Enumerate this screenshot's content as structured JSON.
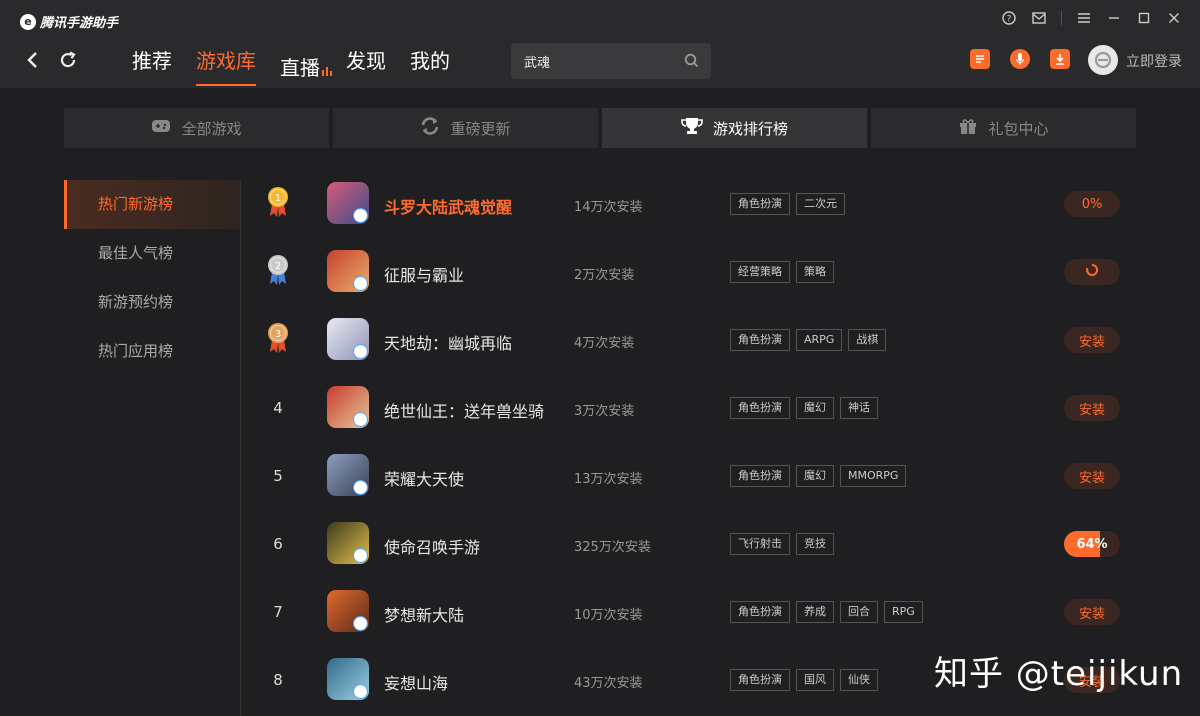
{
  "app": {
    "brand": "腾讯手游助手",
    "logo_letter": "e"
  },
  "window_controls": [
    "help-icon",
    "mail-icon",
    "menu-icon",
    "minimize-icon",
    "maximize-icon",
    "close-icon"
  ],
  "nav": {
    "tabs": [
      {
        "label": "推荐",
        "active": false
      },
      {
        "label": "游戏库",
        "active": true
      },
      {
        "label": "直播",
        "active": false,
        "live": true
      },
      {
        "label": "发现",
        "active": false
      },
      {
        "label": "我的",
        "active": false
      }
    ]
  },
  "search": {
    "value": "武魂"
  },
  "header": {
    "login_label": "立即登录"
  },
  "category_tabs": [
    {
      "label": "全部游戏",
      "icon": "gamepad-icon",
      "active": false
    },
    {
      "label": "重磅更新",
      "icon": "refresh-icon",
      "active": false
    },
    {
      "label": "游戏排行榜",
      "icon": "trophy-icon",
      "active": true
    },
    {
      "label": "礼包中心",
      "icon": "gift-icon",
      "active": false
    }
  ],
  "sidebar": {
    "items": [
      {
        "label": "热门新游榜",
        "active": true
      },
      {
        "label": "最佳人气榜",
        "active": false
      },
      {
        "label": "新游预约榜",
        "active": false
      },
      {
        "label": "热门应用榜",
        "active": false
      }
    ]
  },
  "colors": {
    "accent": "#ff6b2b",
    "gold": "#f5b82e",
    "silver": "#c9c9c9",
    "bronze": "#e3a35d"
  },
  "games": [
    {
      "rank": "1",
      "medal": "gold",
      "name": "斗罗大陆武魂觉醒",
      "hot": true,
      "installs": "14万次安装",
      "tags": [
        "角色扮演",
        "二次元"
      ],
      "action": "0%",
      "action_type": "percent",
      "progress": 0,
      "icon_colors": [
        "#d85c7a",
        "#3d4c8a"
      ]
    },
    {
      "rank": "2",
      "medal": "silver",
      "name": "征服与霸业",
      "hot": false,
      "installs": "2万次安装",
      "tags": [
        "经营策略",
        "策略"
      ],
      "action": "",
      "action_type": "loading",
      "progress": 0,
      "icon_colors": [
        "#c7402f",
        "#e8b06a"
      ]
    },
    {
      "rank": "3",
      "medal": "bronze",
      "name": "天地劫：幽城再临",
      "hot": false,
      "installs": "4万次安装",
      "tags": [
        "角色扮演",
        "ARPG",
        "战棋"
      ],
      "action": "安装",
      "action_type": "install",
      "progress": 0,
      "icon_colors": [
        "#e9eaf2",
        "#8f93b8"
      ]
    },
    {
      "rank": "4",
      "medal": "",
      "name": "绝世仙王：送年兽坐骑",
      "hot": false,
      "installs": "3万次安装",
      "tags": [
        "角色扮演",
        "魔幻",
        "神话"
      ],
      "action": "安装",
      "action_type": "install",
      "progress": 0,
      "icon_colors": [
        "#c83c2e",
        "#e6c79a"
      ]
    },
    {
      "rank": "5",
      "medal": "",
      "name": "荣耀大天使",
      "hot": false,
      "installs": "13万次安装",
      "tags": [
        "角色扮演",
        "魔幻",
        "MMORPG"
      ],
      "action": "安装",
      "action_type": "install",
      "progress": 0,
      "icon_colors": [
        "#8aa0bf",
        "#3a3f55"
      ]
    },
    {
      "rank": "6",
      "medal": "",
      "name": "使命召唤手游",
      "hot": false,
      "installs": "325万次安装",
      "tags": [
        "飞行射击",
        "竞技"
      ],
      "action": "64%",
      "action_type": "progress",
      "progress": 0.64,
      "icon_colors": [
        "#3d3a1e",
        "#e3c14a"
      ]
    },
    {
      "rank": "7",
      "medal": "",
      "name": "梦想新大陆",
      "hot": false,
      "installs": "10万次安装",
      "tags": [
        "角色扮演",
        "养成",
        "回合",
        "RPG"
      ],
      "action": "安装",
      "action_type": "install",
      "progress": 0,
      "icon_colors": [
        "#e36a2d",
        "#5a2a1a"
      ]
    },
    {
      "rank": "8",
      "medal": "",
      "name": "妄想山海",
      "hot": false,
      "installs": "43万次安装",
      "tags": [
        "角色扮演",
        "国风",
        "仙侠"
      ],
      "action": "安装",
      "action_type": "install",
      "progress": 0,
      "icon_colors": [
        "#2f6a8a",
        "#9ed0e0"
      ]
    }
  ],
  "watermark": "知乎 @teijikun"
}
